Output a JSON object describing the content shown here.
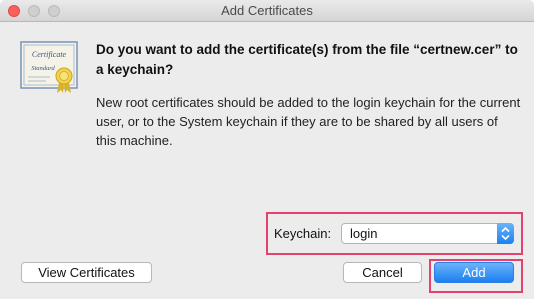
{
  "window": {
    "title": "Add Certificates"
  },
  "icon": {
    "name": "certificate-icon",
    "line1": "Certificate",
    "line2": "Standard"
  },
  "dialog": {
    "headline": "Do you want to add the certificate(s) from the file “certnew.cer” to a keychain?",
    "body": "New root certificates should be added to the login keychain for the current user, or to the System keychain if they are to be shared by all users of this machine."
  },
  "keychain": {
    "label": "Keychain:",
    "selected": "login"
  },
  "buttons": {
    "view_certificates": "View Certificates",
    "cancel": "Cancel",
    "add": "Add"
  },
  "colors": {
    "accent_blue": "#1a82f0",
    "highlight": "#e5416e",
    "close_red": "#fc605c"
  }
}
